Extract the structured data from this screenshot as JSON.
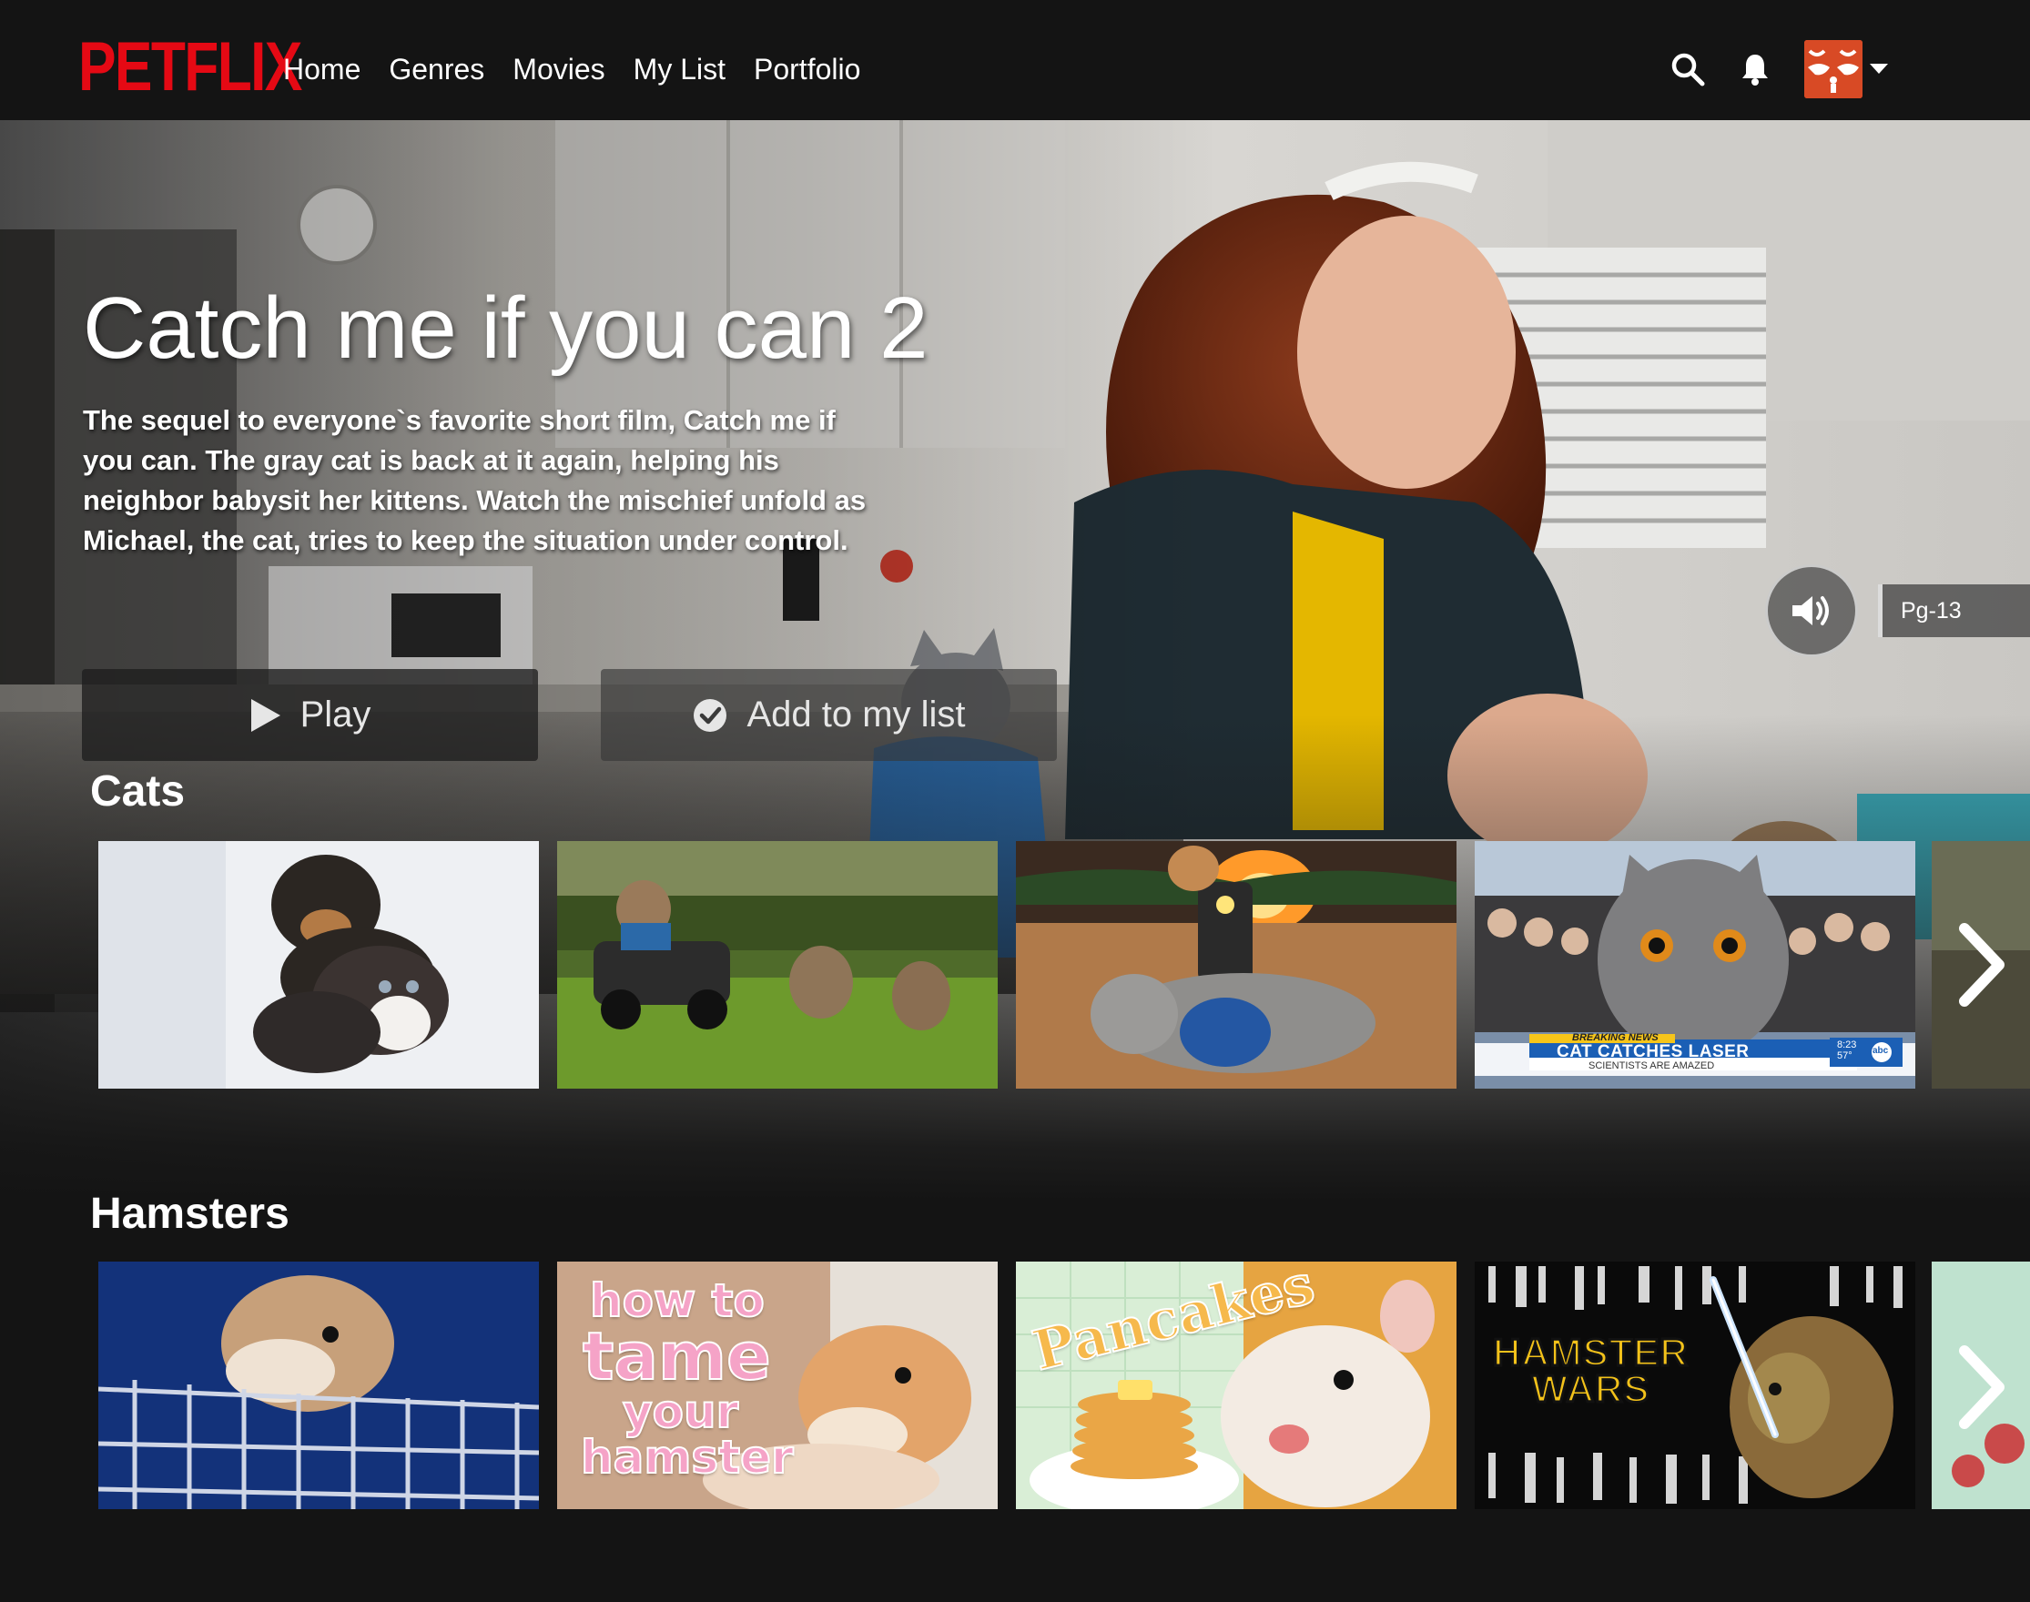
{
  "nav": {
    "logo": "PETFLIX",
    "links": [
      "Home",
      "Genres",
      "Movies",
      "My List",
      "Portfolio"
    ],
    "icons": [
      "search-icon",
      "bell-icon",
      "avatar",
      "chevron-down-icon"
    ]
  },
  "hero": {
    "title": "Catch me if you can 2",
    "description": "The sequel to everyone`s favorite short film, Catch me if you can. The gray cat is back at it again, helping his neighbor babysit her kittens. Watch the mischief unfold as Michael, the cat, tries to keep the situation under control.",
    "play_label": "Play",
    "add_label": "Add to my list",
    "rating": "Pg-13"
  },
  "rows": [
    {
      "title": "Cats",
      "tiles": [
        {
          "name": "puppy-and-kitten"
        },
        {
          "name": "cats-chasing-rc-car"
        },
        {
          "name": "cat-with-toy-train"
        },
        {
          "name": "cat-catches-laser",
          "ticker_tag": "BREAKING NEWS",
          "ticker_headline": "CAT CATCHES LASER",
          "ticker_sub": "SCIENTISTS ARE AMAZED",
          "ticker_time": "8:23",
          "ticker_temp": "57°",
          "ticker_network": "abc"
        },
        {
          "name": "partial-next-tile"
        }
      ]
    },
    {
      "title": "Hamsters",
      "tiles": [
        {
          "name": "hamster-in-cage"
        },
        {
          "name": "how-to-tame-your-hamster",
          "overlay_lines": [
            "how to",
            "tame",
            "your",
            "hamster"
          ]
        },
        {
          "name": "hamster-pancakes",
          "overlay_text": "Pancakes"
        },
        {
          "name": "hamster-wars",
          "overlay_lines": [
            "HAMSTER",
            "WARS"
          ]
        },
        {
          "name": "partial-next-tile"
        }
      ]
    }
  ],
  "colors": {
    "brand": "#e50914",
    "background": "#141414",
    "avatar": "#d84a25"
  }
}
